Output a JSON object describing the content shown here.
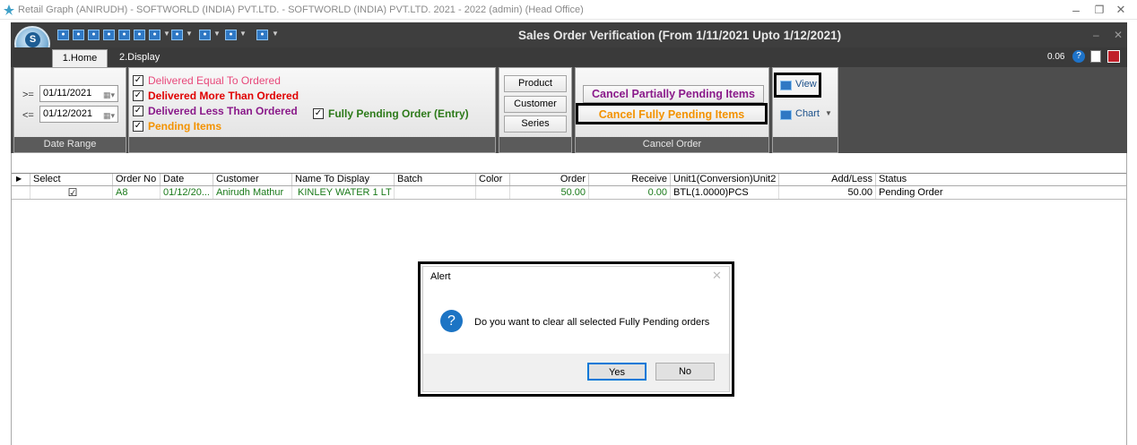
{
  "window": {
    "app_title": "Retail Graph (ANIRUDH) - SOFTWORLD (INDIA) PVT.LTD. - SOFTWORLD (INDIA) PVT.LTD.  2021 - 2022 (admin) (Head Office)",
    "form_title": "Sales Order Verification (From 1/11/2021 Upto 1/12/2021)",
    "version": "0.06",
    "min_glyph": "–",
    "restore_glyph": "❐",
    "close_glyph": "✕"
  },
  "tabs": [
    {
      "label": "1.Home"
    },
    {
      "label": "2.Display"
    }
  ],
  "date_range": {
    "from_op": ">=",
    "from": "01/11/2021",
    "to_op": "<=",
    "to": "01/12/2021",
    "footer": "Date Range"
  },
  "filters": {
    "delivered_equal": "Delivered Equal To Ordered",
    "delivered_more": "Delivered More Than Ordered",
    "delivered_less": "Delivered Less Than Ordered",
    "pending_items": "Pending Items",
    "fully_pending": "Fully Pending Order (Entry)"
  },
  "buttons": {
    "product": "Product",
    "customer": "Customer",
    "series": "Series",
    "cancel_partial": "Cancel Partially Pending Items",
    "cancel_full": "Cancel Fully Pending Items",
    "cancel_footer": "Cancel Order",
    "view": "View",
    "chart": "Chart"
  },
  "grid": {
    "columns": [
      "Select",
      "Order No",
      "Date",
      "Customer",
      "Name To Display",
      "Batch",
      "Color",
      "Order",
      "Receive",
      "Unit1(Conversion)Unit2",
      "Add/Less",
      "Status"
    ],
    "rows": [
      {
        "select": "☑",
        "order_no": "A8",
        "date": "01/12/20...",
        "customer": "Anirudh Mathur",
        "name": "KINLEY WATER 1 LT",
        "batch": "",
        "color": "",
        "order": "50.00",
        "receive": "0.00",
        "unit": "BTL(1.0000)PCS",
        "addless": "50.00",
        "status": "Pending Order"
      }
    ]
  },
  "alert": {
    "title": "Alert",
    "close": "✕",
    "icon": "?",
    "message": "Do you want to clear all selected Fully Pending orders",
    "yes": "Yes",
    "no": "No"
  },
  "colors": {
    "pink": "#e8487a",
    "red": "#e00000",
    "purple": "#8a1a8a",
    "orange": "#f39200",
    "green": "#2d7a1a"
  }
}
